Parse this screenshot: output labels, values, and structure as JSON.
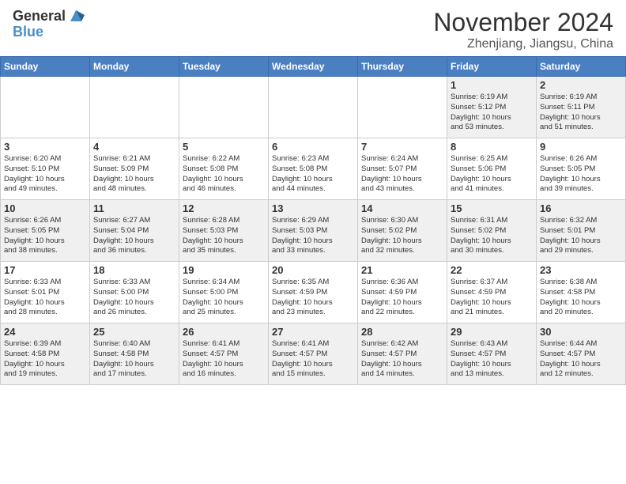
{
  "header": {
    "logo_line1": "General",
    "logo_line2": "Blue",
    "month": "November 2024",
    "location": "Zhenjiang, Jiangsu, China"
  },
  "weekdays": [
    "Sunday",
    "Monday",
    "Tuesday",
    "Wednesday",
    "Thursday",
    "Friday",
    "Saturday"
  ],
  "weeks": [
    [
      {
        "day": "",
        "info": ""
      },
      {
        "day": "",
        "info": ""
      },
      {
        "day": "",
        "info": ""
      },
      {
        "day": "",
        "info": ""
      },
      {
        "day": "",
        "info": ""
      },
      {
        "day": "1",
        "info": "Sunrise: 6:19 AM\nSunset: 5:12 PM\nDaylight: 10 hours\nand 53 minutes."
      },
      {
        "day": "2",
        "info": "Sunrise: 6:19 AM\nSunset: 5:11 PM\nDaylight: 10 hours\nand 51 minutes."
      }
    ],
    [
      {
        "day": "3",
        "info": "Sunrise: 6:20 AM\nSunset: 5:10 PM\nDaylight: 10 hours\nand 49 minutes."
      },
      {
        "day": "4",
        "info": "Sunrise: 6:21 AM\nSunset: 5:09 PM\nDaylight: 10 hours\nand 48 minutes."
      },
      {
        "day": "5",
        "info": "Sunrise: 6:22 AM\nSunset: 5:08 PM\nDaylight: 10 hours\nand 46 minutes."
      },
      {
        "day": "6",
        "info": "Sunrise: 6:23 AM\nSunset: 5:08 PM\nDaylight: 10 hours\nand 44 minutes."
      },
      {
        "day": "7",
        "info": "Sunrise: 6:24 AM\nSunset: 5:07 PM\nDaylight: 10 hours\nand 43 minutes."
      },
      {
        "day": "8",
        "info": "Sunrise: 6:25 AM\nSunset: 5:06 PM\nDaylight: 10 hours\nand 41 minutes."
      },
      {
        "day": "9",
        "info": "Sunrise: 6:26 AM\nSunset: 5:05 PM\nDaylight: 10 hours\nand 39 minutes."
      }
    ],
    [
      {
        "day": "10",
        "info": "Sunrise: 6:26 AM\nSunset: 5:05 PM\nDaylight: 10 hours\nand 38 minutes."
      },
      {
        "day": "11",
        "info": "Sunrise: 6:27 AM\nSunset: 5:04 PM\nDaylight: 10 hours\nand 36 minutes."
      },
      {
        "day": "12",
        "info": "Sunrise: 6:28 AM\nSunset: 5:03 PM\nDaylight: 10 hours\nand 35 minutes."
      },
      {
        "day": "13",
        "info": "Sunrise: 6:29 AM\nSunset: 5:03 PM\nDaylight: 10 hours\nand 33 minutes."
      },
      {
        "day": "14",
        "info": "Sunrise: 6:30 AM\nSunset: 5:02 PM\nDaylight: 10 hours\nand 32 minutes."
      },
      {
        "day": "15",
        "info": "Sunrise: 6:31 AM\nSunset: 5:02 PM\nDaylight: 10 hours\nand 30 minutes."
      },
      {
        "day": "16",
        "info": "Sunrise: 6:32 AM\nSunset: 5:01 PM\nDaylight: 10 hours\nand 29 minutes."
      }
    ],
    [
      {
        "day": "17",
        "info": "Sunrise: 6:33 AM\nSunset: 5:01 PM\nDaylight: 10 hours\nand 28 minutes."
      },
      {
        "day": "18",
        "info": "Sunrise: 6:33 AM\nSunset: 5:00 PM\nDaylight: 10 hours\nand 26 minutes."
      },
      {
        "day": "19",
        "info": "Sunrise: 6:34 AM\nSunset: 5:00 PM\nDaylight: 10 hours\nand 25 minutes."
      },
      {
        "day": "20",
        "info": "Sunrise: 6:35 AM\nSunset: 4:59 PM\nDaylight: 10 hours\nand 23 minutes."
      },
      {
        "day": "21",
        "info": "Sunrise: 6:36 AM\nSunset: 4:59 PM\nDaylight: 10 hours\nand 22 minutes."
      },
      {
        "day": "22",
        "info": "Sunrise: 6:37 AM\nSunset: 4:59 PM\nDaylight: 10 hours\nand 21 minutes."
      },
      {
        "day": "23",
        "info": "Sunrise: 6:38 AM\nSunset: 4:58 PM\nDaylight: 10 hours\nand 20 minutes."
      }
    ],
    [
      {
        "day": "24",
        "info": "Sunrise: 6:39 AM\nSunset: 4:58 PM\nDaylight: 10 hours\nand 19 minutes."
      },
      {
        "day": "25",
        "info": "Sunrise: 6:40 AM\nSunset: 4:58 PM\nDaylight: 10 hours\nand 17 minutes."
      },
      {
        "day": "26",
        "info": "Sunrise: 6:41 AM\nSunset: 4:57 PM\nDaylight: 10 hours\nand 16 minutes."
      },
      {
        "day": "27",
        "info": "Sunrise: 6:41 AM\nSunset: 4:57 PM\nDaylight: 10 hours\nand 15 minutes."
      },
      {
        "day": "28",
        "info": "Sunrise: 6:42 AM\nSunset: 4:57 PM\nDaylight: 10 hours\nand 14 minutes."
      },
      {
        "day": "29",
        "info": "Sunrise: 6:43 AM\nSunset: 4:57 PM\nDaylight: 10 hours\nand 13 minutes."
      },
      {
        "day": "30",
        "info": "Sunrise: 6:44 AM\nSunset: 4:57 PM\nDaylight: 10 hours\nand 12 minutes."
      }
    ]
  ]
}
